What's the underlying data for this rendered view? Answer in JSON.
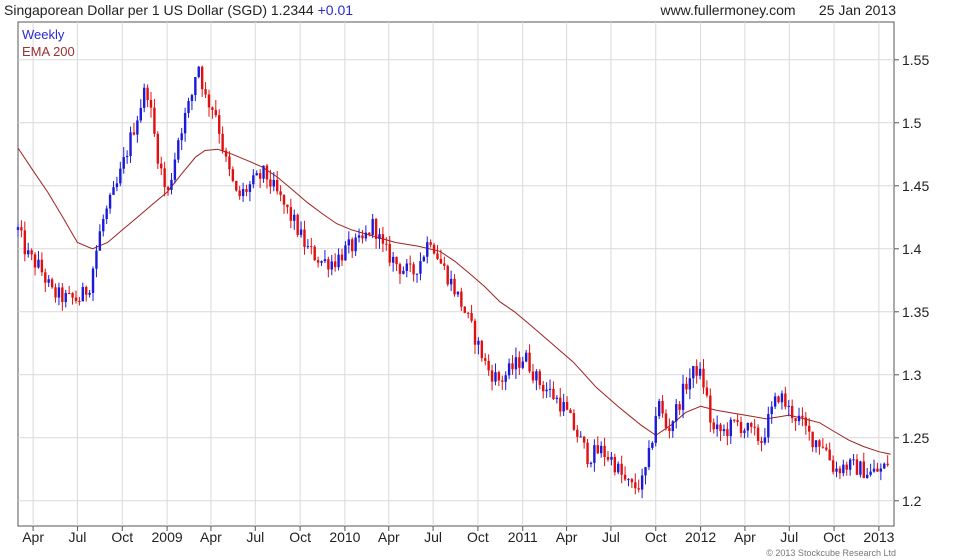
{
  "header": {
    "title": "Singaporean Dollar per 1 US Dollar (SGD) 1.2344",
    "change": "+0.01",
    "site": "www.fullermoney.com",
    "date": "25 Jan 2013"
  },
  "copyright": "© 2013 Stockcube Research Ltd",
  "colors": {
    "up": "#1a1ad8",
    "down": "#e01010",
    "ema": "#a02020",
    "grid": "#d9d9d9",
    "axis": "#555555"
  },
  "chart_data": {
    "type": "candlestick",
    "title": "Singaporean Dollar per 1 US Dollar (SGD) 1.2344",
    "interval": "Weekly",
    "indicator": "EMA 200",
    "legend": [
      "Weekly",
      "EMA 200"
    ],
    "legend_position": "top-left",
    "grid": true,
    "x_range": [
      "2008-03-01",
      "2013-02-01"
    ],
    "ylim": [
      1.18,
      1.58
    ],
    "y_axis_side": "right",
    "y_ticks": [
      1.2,
      1.25,
      1.3,
      1.35,
      1.4,
      1.45,
      1.5,
      1.55
    ],
    "y_tick_labels": [
      "1.2",
      "1.25",
      "1.3",
      "1.35",
      "1.4",
      "1.45",
      "1.5",
      "1.55"
    ],
    "x_ticks": [
      {
        "date": "2008-04-01",
        "label": "Apr"
      },
      {
        "date": "2008-07-01",
        "label": "Jul"
      },
      {
        "date": "2008-10-01",
        "label": "Oct"
      },
      {
        "date": "2009-01-01",
        "label": "2009"
      },
      {
        "date": "2009-04-01",
        "label": "Apr"
      },
      {
        "date": "2009-07-01",
        "label": "Jul"
      },
      {
        "date": "2009-10-01",
        "label": "Oct"
      },
      {
        "date": "2010-01-01",
        "label": "2010"
      },
      {
        "date": "2010-04-01",
        "label": "Apr"
      },
      {
        "date": "2010-07-01",
        "label": "Jul"
      },
      {
        "date": "2010-10-01",
        "label": "Oct"
      },
      {
        "date": "2011-01-01",
        "label": "2011"
      },
      {
        "date": "2011-04-01",
        "label": "Apr"
      },
      {
        "date": "2011-07-01",
        "label": "Jul"
      },
      {
        "date": "2011-10-01",
        "label": "Oct"
      },
      {
        "date": "2012-01-01",
        "label": "2012"
      },
      {
        "date": "2012-04-01",
        "label": "Apr"
      },
      {
        "date": "2012-07-01",
        "label": "Jul"
      },
      {
        "date": "2012-10-01",
        "label": "Oct"
      },
      {
        "date": "2013-01-01",
        "label": "2013"
      }
    ],
    "price_path": [
      [
        "2008-03-01",
        1.415
      ],
      [
        "2008-03-20",
        1.395
      ],
      [
        "2008-04-15",
        1.385
      ],
      [
        "2008-05-10",
        1.365
      ],
      [
        "2008-06-10",
        1.36
      ],
      [
        "2008-07-05",
        1.36
      ],
      [
        "2008-07-25",
        1.37
      ],
      [
        "2008-08-20",
        1.42
      ],
      [
        "2008-09-20",
        1.45
      ],
      [
        "2008-10-20",
        1.49
      ],
      [
        "2008-11-20",
        1.53
      ],
      [
        "2008-12-10",
        1.48
      ],
      [
        "2009-01-01",
        1.44
      ],
      [
        "2009-01-25",
        1.49
      ],
      [
        "2009-02-20",
        1.52
      ],
      [
        "2009-03-05",
        1.55
      ],
      [
        "2009-03-20",
        1.52
      ],
      [
        "2009-04-10",
        1.51
      ],
      [
        "2009-05-01",
        1.47
      ],
      [
        "2009-05-25",
        1.44
      ],
      [
        "2009-06-20",
        1.45
      ],
      [
        "2009-07-20",
        1.46
      ],
      [
        "2009-08-20",
        1.44
      ],
      [
        "2009-09-20",
        1.42
      ],
      [
        "2009-10-15",
        1.4
      ],
      [
        "2009-11-15",
        1.39
      ],
      [
        "2009-12-10",
        1.39
      ],
      [
        "2010-01-05",
        1.4
      ],
      [
        "2010-02-05",
        1.405
      ],
      [
        "2010-03-01",
        1.42
      ],
      [
        "2010-03-20",
        1.4
      ],
      [
        "2010-04-25",
        1.385
      ],
      [
        "2010-05-20",
        1.38
      ],
      [
        "2010-06-10",
        1.395
      ],
      [
        "2010-06-25",
        1.41
      ],
      [
        "2010-07-15",
        1.39
      ],
      [
        "2010-08-05",
        1.375
      ],
      [
        "2010-08-30",
        1.355
      ],
      [
        "2010-09-25",
        1.33
      ],
      [
        "2010-10-20",
        1.305
      ],
      [
        "2010-11-15",
        1.295
      ],
      [
        "2010-12-10",
        1.305
      ],
      [
        "2011-01-05",
        1.315
      ],
      [
        "2011-02-01",
        1.295
      ],
      [
        "2011-03-01",
        1.285
      ],
      [
        "2011-03-25",
        1.275
      ],
      [
        "2011-04-20",
        1.255
      ],
      [
        "2011-05-15",
        1.235
      ],
      [
        "2011-06-10",
        1.24
      ],
      [
        "2011-07-05",
        1.232
      ],
      [
        "2011-07-30",
        1.215
      ],
      [
        "2011-08-15",
        1.21
      ],
      [
        "2011-09-05",
        1.215
      ],
      [
        "2011-09-20",
        1.24
      ],
      [
        "2011-10-05",
        1.28
      ],
      [
        "2011-10-25",
        1.255
      ],
      [
        "2011-11-15",
        1.275
      ],
      [
        "2011-12-05",
        1.295
      ],
      [
        "2011-12-25",
        1.305
      ],
      [
        "2012-01-10",
        1.29
      ],
      [
        "2012-01-25",
        1.255
      ],
      [
        "2012-02-20",
        1.255
      ],
      [
        "2012-03-15",
        1.262
      ],
      [
        "2012-04-10",
        1.255
      ],
      [
        "2012-05-05",
        1.248
      ],
      [
        "2012-05-25",
        1.27
      ],
      [
        "2012-06-10",
        1.285
      ],
      [
        "2012-06-30",
        1.272
      ],
      [
        "2012-07-20",
        1.265
      ],
      [
        "2012-08-15",
        1.25
      ],
      [
        "2012-09-10",
        1.245
      ],
      [
        "2012-10-01",
        1.225
      ],
      [
        "2012-10-25",
        1.228
      ],
      [
        "2012-11-20",
        1.226
      ],
      [
        "2012-12-15",
        1.222
      ],
      [
        "2013-01-10",
        1.225
      ],
      [
        "2013-01-25",
        1.2344
      ]
    ],
    "ema_200": [
      [
        "2008-03-01",
        1.48
      ],
      [
        "2008-04-01",
        1.462
      ],
      [
        "2008-05-01",
        1.445
      ],
      [
        "2008-06-01",
        1.425
      ],
      [
        "2008-07-01",
        1.405
      ],
      [
        "2008-08-01",
        1.4
      ],
      [
        "2008-09-01",
        1.405
      ],
      [
        "2008-10-01",
        1.415
      ],
      [
        "2008-11-01",
        1.425
      ],
      [
        "2008-12-01",
        1.435
      ],
      [
        "2009-01-01",
        1.445
      ],
      [
        "2009-02-01",
        1.46
      ],
      [
        "2009-03-01",
        1.473
      ],
      [
        "2009-03-20",
        1.478
      ],
      [
        "2009-04-15",
        1.479
      ],
      [
        "2009-05-15",
        1.475
      ],
      [
        "2009-06-15",
        1.47
      ],
      [
        "2009-07-15",
        1.465
      ],
      [
        "2009-08-15",
        1.457
      ],
      [
        "2009-09-15",
        1.447
      ],
      [
        "2009-10-15",
        1.437
      ],
      [
        "2009-11-15",
        1.428
      ],
      [
        "2009-12-15",
        1.42
      ],
      [
        "2010-01-15",
        1.415
      ],
      [
        "2010-03-01",
        1.41
      ],
      [
        "2010-04-15",
        1.405
      ],
      [
        "2010-06-01",
        1.402
      ],
      [
        "2010-07-15",
        1.398
      ],
      [
        "2010-08-15",
        1.39
      ],
      [
        "2010-09-15",
        1.38
      ],
      [
        "2010-10-15",
        1.37
      ],
      [
        "2010-11-15",
        1.358
      ],
      [
        "2010-12-15",
        1.35
      ],
      [
        "2011-01-15",
        1.34
      ],
      [
        "2011-03-01",
        1.325
      ],
      [
        "2011-04-15",
        1.31
      ],
      [
        "2011-06-01",
        1.29
      ],
      [
        "2011-07-15",
        1.275
      ],
      [
        "2011-09-01",
        1.26
      ],
      [
        "2011-10-01",
        1.252
      ],
      [
        "2011-11-01",
        1.26
      ],
      [
        "2011-12-01",
        1.27
      ],
      [
        "2012-01-01",
        1.275
      ],
      [
        "2012-02-01",
        1.272
      ],
      [
        "2012-03-01",
        1.27
      ],
      [
        "2012-04-01",
        1.268
      ],
      [
        "2012-05-15",
        1.265
      ],
      [
        "2012-07-01",
        1.268
      ],
      [
        "2012-08-01",
        1.265
      ],
      [
        "2012-09-01",
        1.262
      ],
      [
        "2012-10-01",
        1.255
      ],
      [
        "2012-11-01",
        1.248
      ],
      [
        "2012-12-01",
        1.243
      ],
      [
        "2013-01-01",
        1.239
      ],
      [
        "2013-01-25",
        1.237
      ]
    ]
  }
}
